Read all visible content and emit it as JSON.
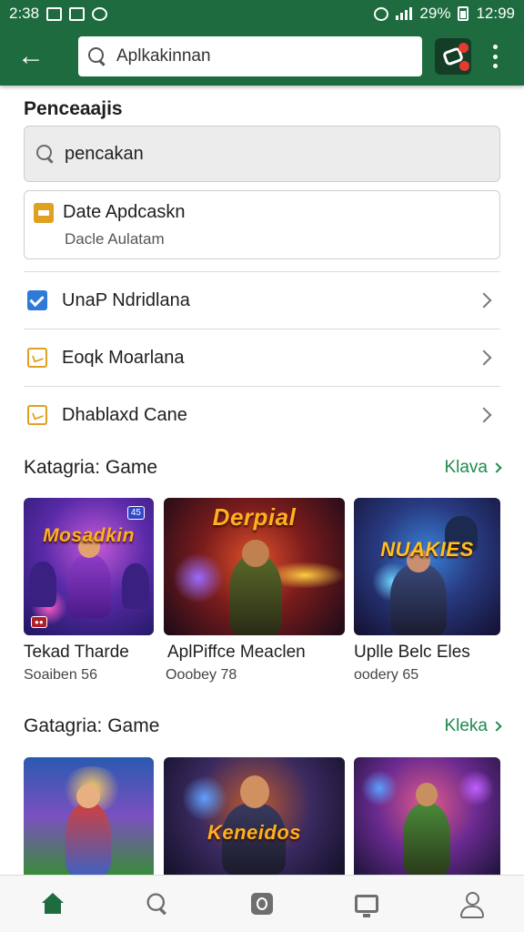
{
  "status_bar": {
    "time_left": "2:38",
    "battery": "29%",
    "time_right": "12:99"
  },
  "app_bar": {
    "search_text": "Aplkakinnan"
  },
  "filter_section": {
    "title": "Penceaajis",
    "search_value": "pencakan",
    "date_card": {
      "title": "Date Apdcaskn",
      "subtitle": "Dacle Aulatam"
    },
    "items": [
      {
        "label": "UnaP Ndridlana",
        "icon": "check-icon"
      },
      {
        "label": "Eoqk Moarlana",
        "icon": "category-icon"
      },
      {
        "label": "Dhablaxd Cane",
        "icon": "category-icon"
      }
    ]
  },
  "category_1": {
    "title": "Katagria: Game",
    "more_label": "Klava",
    "games": [
      {
        "name": "Tekad Tharde",
        "meta": "Soaiben 56",
        "logo": "Mosadkin",
        "badge": "45"
      },
      {
        "name": "AplPiffce Meaclen",
        "meta": "Ooobey 78",
        "logo": "Derpial"
      },
      {
        "name": "Uplle Belc Eles",
        "meta": "oodery 65",
        "logo": "NUAKIES"
      }
    ]
  },
  "category_2": {
    "title": "Gatagria: Game",
    "more_label": "Kleka",
    "games": [
      {
        "logo": ""
      },
      {
        "logo": "Keneidos"
      },
      {
        "logo": ""
      }
    ]
  },
  "colors": {
    "app_bar": "#1d6b3f",
    "accent_link": "#1f8a4c",
    "check_blue": "#2f7ad9",
    "category_orange": "#e0a020"
  },
  "bottom_nav": [
    "home-icon",
    "search-icon",
    "library-icon",
    "tv-icon",
    "profile-icon"
  ]
}
